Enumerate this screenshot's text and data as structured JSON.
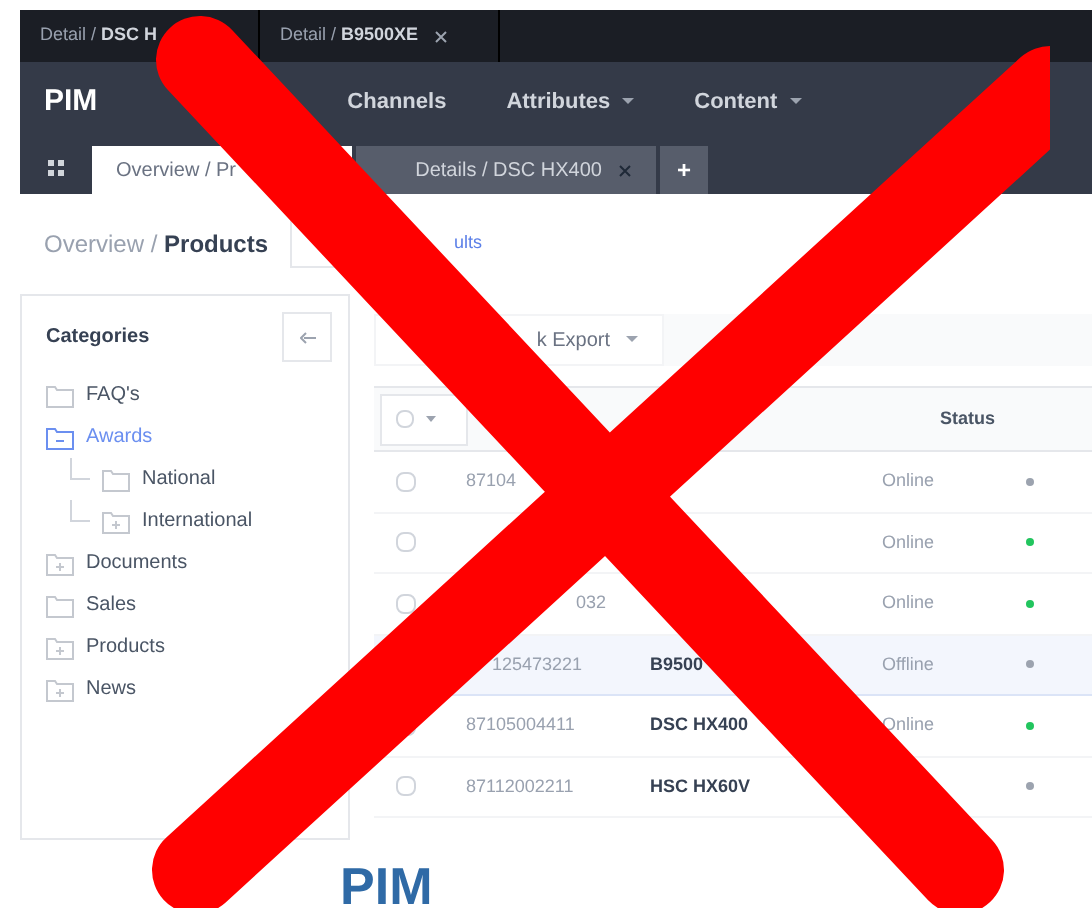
{
  "window_tabs": [
    {
      "label": "Detail / ",
      "bold": "DSC H"
    },
    {
      "label": "Detail / ",
      "bold": "B9500XE",
      "closable": true
    }
  ],
  "navbar": {
    "logo": "PIM",
    "items": [
      {
        "label": "Channels",
        "dropdown": false
      },
      {
        "label": "Attributes",
        "dropdown": true
      },
      {
        "label": "Content",
        "dropdown": true
      }
    ]
  },
  "page_tabs": [
    {
      "label": "Overview / Pr",
      "selected": true,
      "closable": false
    },
    {
      "label": "Details / DSC HX400",
      "selected": false,
      "closable": true
    }
  ],
  "add_tab": "+",
  "breadcrumb": {
    "parent": "Overview / ",
    "current": "Products",
    "link": "ults"
  },
  "sidebar": {
    "title": "Categories",
    "items": [
      {
        "label": "FAQ's",
        "expandable": false,
        "expanded": false
      },
      {
        "label": "Awards",
        "expandable": true,
        "expanded": true,
        "children": [
          {
            "label": "National",
            "expandable": false,
            "expanded": false
          },
          {
            "label": "International",
            "expandable": true,
            "expanded": false
          }
        ]
      },
      {
        "label": "Documents",
        "expandable": true,
        "expanded": false
      },
      {
        "label": "Sales",
        "expandable": false,
        "expanded": false
      },
      {
        "label": "Products",
        "expandable": true,
        "expanded": false
      },
      {
        "label": "News",
        "expandable": true,
        "expanded": false
      }
    ]
  },
  "toolbar": {
    "export": "k Export"
  },
  "table": {
    "select_all_checked": false,
    "columns": [
      "Status"
    ],
    "rows": [
      {
        "sku": "87104",
        "status": "Online",
        "selected": false,
        "color": "#9ca3af"
      },
      {
        "status": "Online",
        "selected": false,
        "color": "#22c55e"
      },
      {
        "sku": "032",
        "status": "Online",
        "selected": false,
        "color": "#22c55e"
      },
      {
        "sku": "125473221",
        "name": "B9500",
        "status": "Offline",
        "selected": true,
        "color": "#9ca3af"
      },
      {
        "sku": "87105004411",
        "name": "DSC HX400",
        "status": "Online",
        "selected": false,
        "color": "#22c55e"
      },
      {
        "sku": "87112002211",
        "name": "HSC HX60V",
        "selected": false,
        "color": "#9ca3af"
      }
    ]
  },
  "footer_title": "PIM"
}
